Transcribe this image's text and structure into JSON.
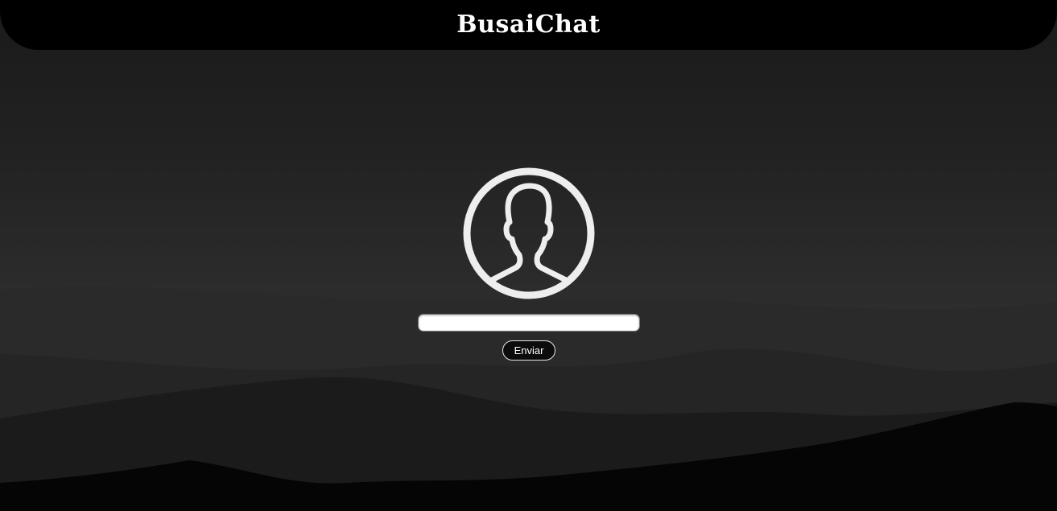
{
  "header": {
    "title": "BusaiChat"
  },
  "login": {
    "avatar_icon": "user-silhouette-icon",
    "name_input": {
      "value": "",
      "placeholder": ""
    },
    "submit_label": "Enviar"
  },
  "colors": {
    "header_bg": "#000000",
    "page_bg": "#1e1e1e",
    "icon_stroke": "#eeeeee",
    "button_bg": "#0c0c0c",
    "button_border": "#e8e8e8"
  }
}
